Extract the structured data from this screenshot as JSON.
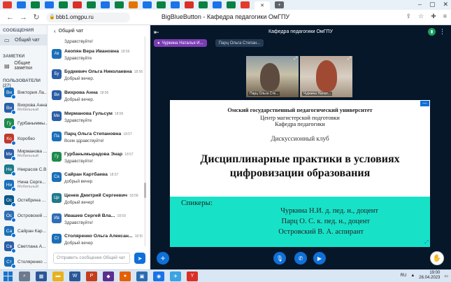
{
  "browser": {
    "url": "bbb1.omgpu.ru",
    "page_title": "BigBlueButton - Кафедра педагогики ОмГПУ"
  },
  "left_panel": {
    "messages_header": "СООБЩЕНИЯ",
    "public_chat": "Общий чат",
    "notes_header": "ЗАМЕТКИ",
    "shared_notes": "Общие заметки",
    "users_header": "ПОЛЬЗОВАТЕЛИ (27)",
    "users": [
      {
        "initials": "Ви",
        "name": "Виктория Ла...",
        "sub": "",
        "color": "#1b6fb8"
      },
      {
        "initials": "Ви",
        "name": "Вихрова Анна",
        "sub": "Мобильный",
        "color": "#2a5fa8"
      },
      {
        "initials": "Гу",
        "name": "Гурбаныммы...",
        "sub": "",
        "color": "#1f8a4c"
      },
      {
        "initials": "Ко",
        "name": "Коробко",
        "sub": "",
        "color": "#c0392b"
      },
      {
        "initials": "Ми",
        "name": "Мирманова ...",
        "sub": "Мобильный",
        "color": "#2a5fa8"
      },
      {
        "initials": "Не",
        "name": "Некрасов С.В.",
        "sub": "",
        "color": "#1d7a8c"
      },
      {
        "initials": "Ни",
        "name": "Нина Серге...",
        "sub": "Мобильный",
        "color": "#1b6fb8"
      },
      {
        "initials": "Ос",
        "name": "Остябрина ...",
        "sub": "",
        "color": "#0b5a8a"
      },
      {
        "initials": "Ос",
        "name": "Островский ...",
        "sub": "",
        "color": "#2f6db5"
      },
      {
        "initials": "Са",
        "name": "Сайран Кар...",
        "sub": "",
        "color": "#1b6fb8"
      },
      {
        "initials": "Св",
        "name": "Светлана А...",
        "sub": "",
        "color": "#2a5fa8"
      },
      {
        "initials": "Ст",
        "name": "Столяренко ...",
        "sub": "",
        "color": "#1b6fb8"
      }
    ]
  },
  "chat": {
    "header": "Общий чат",
    "top_text": "Здравствуйте!",
    "messages": [
      {
        "initials": "Ак",
        "name": "Акопян Вера Ивановна",
        "time": "18:56",
        "text": "Здравствуйте",
        "color": "#1b6fb8"
      },
      {
        "initials": "Бу",
        "name": "Будкевич Ольга Николаевна",
        "time": "18:56",
        "text": "Добрый вечер.",
        "color": "#2a5fa8"
      },
      {
        "initials": "Ви",
        "name": "Вихрова Анна",
        "time": "18:56",
        "text": "Добрый вечер.",
        "color": "#2a5fa8"
      },
      {
        "initials": "Ми",
        "name": "Мирманова Гульсум",
        "time": "18:56",
        "text": "Здравствуйте",
        "color": "#2a5fa8"
      },
      {
        "initials": "Па",
        "name": "Парц Ольга Степановна",
        "time": "18:57",
        "text": "Всем здравствуйте!",
        "color": "#1b6fb8"
      },
      {
        "initials": "Гу",
        "name": "Гурбанымырадова Энар",
        "time": "18:57",
        "text": "Здравствуйте!",
        "color": "#1f8a4c"
      },
      {
        "initials": "Са",
        "name": "Сайран Картбаева",
        "time": "18:57",
        "text": "добрый вечер",
        "color": "#1b6fb8"
      },
      {
        "initials": "Це",
        "name": "Ценев Дмитрий Сергеевич",
        "time": "18:58",
        "text": "Добрый вечер!",
        "color": "#1d7a8c"
      },
      {
        "initials": "Ив",
        "name": "Ивашев Сергей Вла...",
        "time": "18:59",
        "text": "Здравствуйте!",
        "color": "#2f6db5"
      },
      {
        "initials": "Ст",
        "name": "Столяренко Ольга Алексан...",
        "time": "18:59",
        "text": "Добрый вечер",
        "color": "#1b6fb8"
      }
    ],
    "input_placeholder": "Отправить сообщение Общий чат"
  },
  "meeting": {
    "title": "Кафедра педагогики ОмГПУ",
    "talkers": [
      {
        "name": "Чуркина Наталья И...",
        "state": "speaking"
      },
      {
        "name": "Парц Ольга Степан...",
        "state": "muted"
      }
    ],
    "videos": [
      {
        "label": "Парц Ольга Сте..."
      },
      {
        "label": "Чуркина Натал..."
      }
    ]
  },
  "slide": {
    "university": "Омский государственный педагогический университет",
    "center": "Центр магистерской подготовки",
    "department": "Кафедра педагогики",
    "club": "Дискуссионный клуб",
    "headline_line1": "Дисциплинарные практики в условиях",
    "headline_line2": "цифровизации образования",
    "speakers_label": "Спикеры:",
    "speakers": [
      "Чуркина Н.И. д. пед. н., доцент",
      "Парц О. С. к. пед. н., доцент",
      "Островский В. А. аспирант"
    ]
  },
  "taskbar": {
    "lang": "RU",
    "time": "19:00",
    "date": "26.04.2023"
  },
  "colors": {
    "accent": "#0f70d7",
    "slide_band": "#17e2c8",
    "main_bg": "#06172a"
  }
}
